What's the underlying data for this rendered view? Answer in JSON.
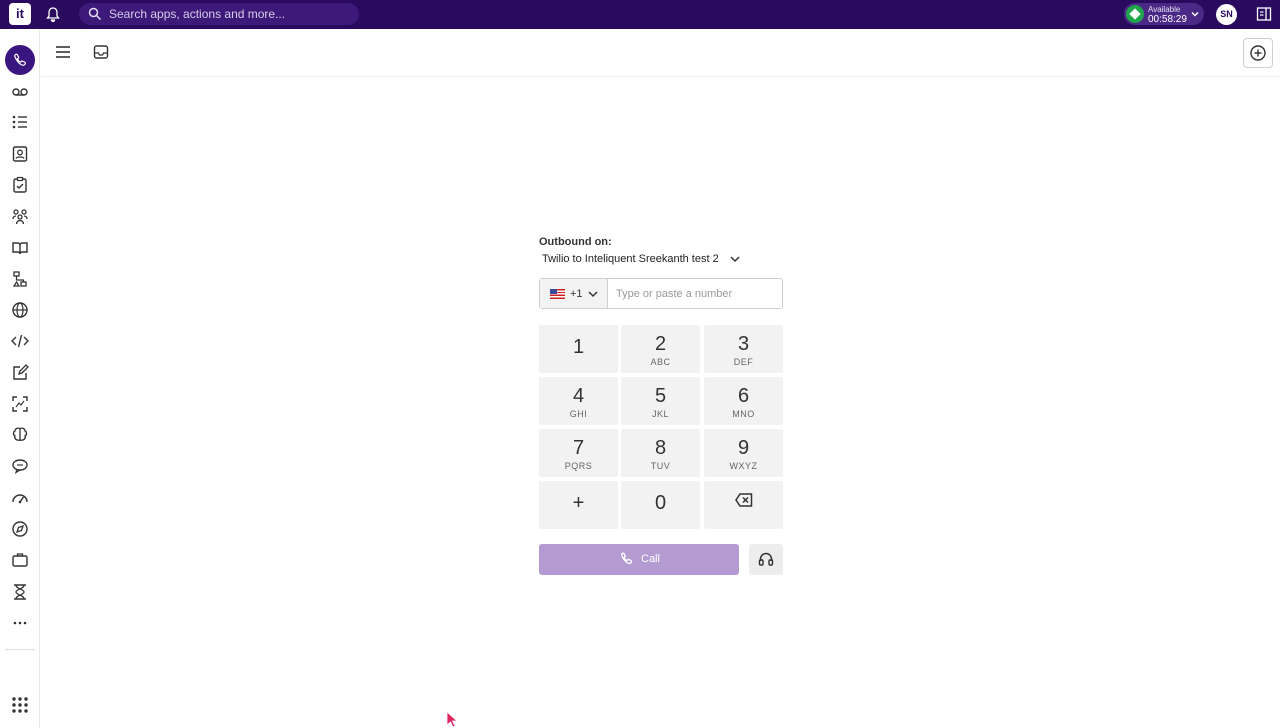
{
  "topbar": {
    "logo_text": "it",
    "search_placeholder": "Search apps, actions and more...",
    "status": {
      "label": "Available",
      "time": "00:58:29",
      "color": "#1fa64a"
    },
    "avatar_initials": "SN",
    "background_color": "#2a0a5e"
  },
  "sidebar": {
    "active_item": "phone-icon",
    "icons": [
      "voicemail-icon",
      "list-icon",
      "contacts-icon",
      "clipboard-check-icon",
      "team-icon",
      "book-icon",
      "flow-icon",
      "globe-icon",
      "code-icon",
      "edit-icon",
      "scan-icon",
      "brain-icon",
      "chat-icon",
      "gauge-icon",
      "compass-icon",
      "briefcase-icon",
      "hourglass-icon",
      "more-icon",
      "apps-grid-icon"
    ]
  },
  "dialer": {
    "outbound_label": "Outbound on:",
    "outbound_line": "Twilio to Inteliquent Sreekanth test 2",
    "country_code": "+1",
    "number_placeholder": "Type or paste a number",
    "keys": [
      {
        "digit": "1",
        "letters": ""
      },
      {
        "digit": "2",
        "letters": "ABC"
      },
      {
        "digit": "3",
        "letters": "DEF"
      },
      {
        "digit": "4",
        "letters": "GHI"
      },
      {
        "digit": "5",
        "letters": "JKL"
      },
      {
        "digit": "6",
        "letters": "MNO"
      },
      {
        "digit": "7",
        "letters": "PQRS"
      },
      {
        "digit": "8",
        "letters": "TUV"
      },
      {
        "digit": "9",
        "letters": "WXYZ"
      },
      {
        "digit": "+",
        "letters": ""
      },
      {
        "digit": "0",
        "letters": ""
      }
    ],
    "call_label": "Call",
    "call_color": "#b39bd2"
  }
}
